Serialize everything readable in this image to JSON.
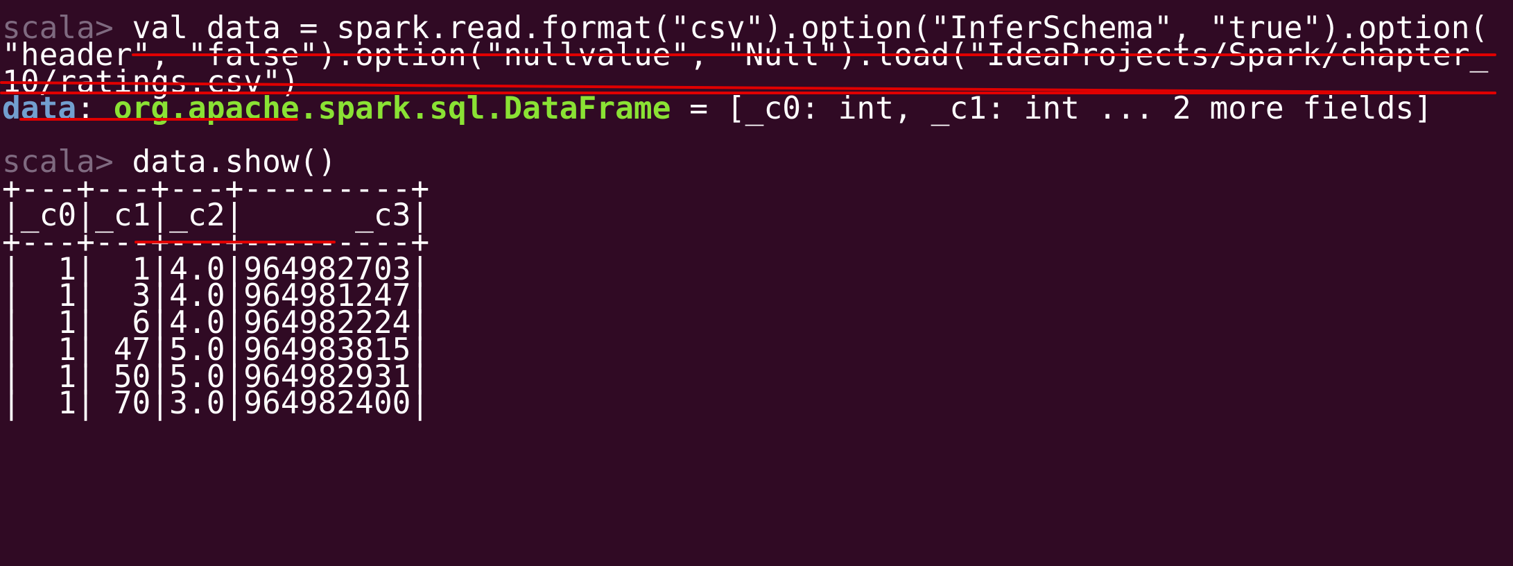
{
  "terminal": {
    "prompt": "scala>",
    "command1": {
      "line1": "val data = spark.read.format(\"csv\").option(\"InferSchema\", \"true\").option(",
      "line2": "\"header\", \"false\").option(\"nullvalue\", \"Null\").load(\"IdeaProjects/Spark/chapter_",
      "line3": "10/ratings.csv\")"
    },
    "result1": {
      "name": "data",
      "colon": ": ",
      "type": "org.apache.spark.sql.DataFrame",
      "rest": " = [_c0: int, _c1: int ... 2 more fields]"
    },
    "command2": "data.show()",
    "table": {
      "separator": "+---+---+---+---------+",
      "header": "|_c0|_c1|_c2|      _c3|",
      "rows": [
        "|  1|  1|4.0|964982703|",
        "|  1|  3|4.0|964981247|",
        "|  1|  6|4.0|964982224|",
        "|  1| 47|5.0|964983815|",
        "|  1| 50|5.0|964982931|",
        "|  1| 70|3.0|964982400|"
      ]
    },
    "colors": {
      "background": "#300a24",
      "prompt": "#7f6a80",
      "variable": "#729fcf",
      "type": "#8ae234",
      "text": "#ffffff",
      "annotation_underline": "#e00000"
    }
  }
}
